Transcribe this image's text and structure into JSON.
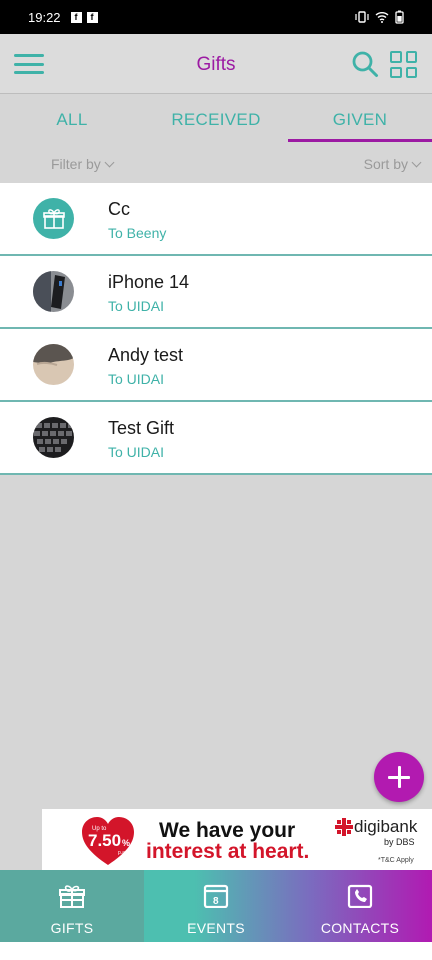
{
  "status_bar": {
    "time": "19:22",
    "notification_icons": [
      "facebook-icon",
      "facebook-icon"
    ],
    "right_icons": [
      "vibrate-icon",
      "wifi-icon",
      "battery-icon"
    ]
  },
  "app_bar": {
    "title": "Gifts",
    "left_icon": "menu-icon",
    "right_icons": [
      "search-icon",
      "grid-view-icon"
    ],
    "title_color": "#9c1aa3",
    "accent_color": "#3fb2a8"
  },
  "tabs": [
    {
      "label": "ALL",
      "active": false
    },
    {
      "label": "RECEIVED",
      "active": false
    },
    {
      "label": "GIVEN",
      "active": true
    }
  ],
  "filters": {
    "filter_label": "Filter by",
    "sort_label": "Sort by"
  },
  "gifts": [
    {
      "title": " Cc",
      "subtitle": "To Beeny",
      "image": "gift-icon"
    },
    {
      "title": "iPhone 14",
      "subtitle": "To UIDAI",
      "image": "photo-phone"
    },
    {
      "title": "Andy test",
      "subtitle": "To UIDAI",
      "image": "photo-floor"
    },
    {
      "title": "Test Gift",
      "subtitle": "To UIDAI",
      "image": "photo-keyboard"
    }
  ],
  "fab": {
    "icon": "plus-icon",
    "color": "#b21ab0"
  },
  "ad": {
    "badge_top": "Up to",
    "badge_value": "7.50",
    "badge_unit": "%",
    "badge_suffix": "p.a.",
    "line1": "We have your",
    "line2": "interest at heart.",
    "brand": "digibank",
    "brand_sub": "by DBS",
    "tc": "*T&C Apply"
  },
  "bottom_nav": [
    {
      "label": "GIFTS",
      "icon": "gift-icon",
      "active": true
    },
    {
      "label": "EVENTS",
      "icon": "calendar-icon",
      "active": false,
      "icon_text": "8"
    },
    {
      "label": "CONTACTS",
      "icon": "contacts-icon",
      "active": false
    }
  ]
}
